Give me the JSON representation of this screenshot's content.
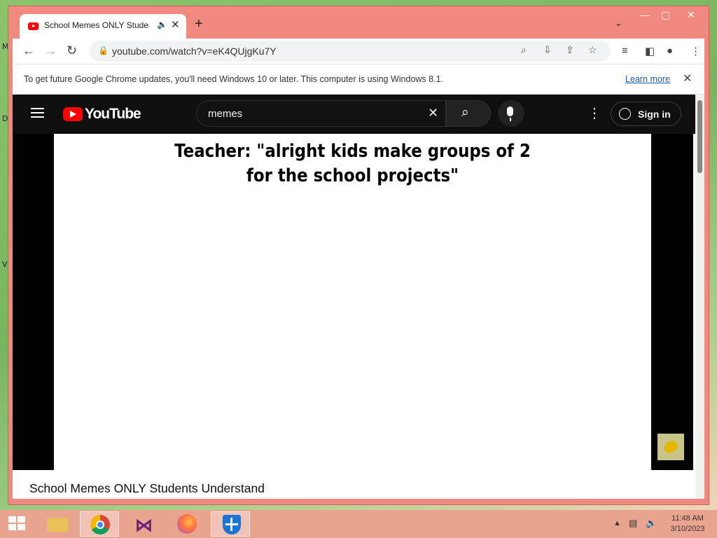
{
  "desktop": {
    "edge_letters": [
      "M",
      "D",
      "V"
    ]
  },
  "browser": {
    "tab": {
      "title": "School Memes ONLY Students Understand"
    },
    "url": "youtube.com/watch?v=eK4QUjgKu7Y",
    "infobar": {
      "message": "To get future Google Chrome updates, you'll need Windows 10 or later. This computer is using Windows 8.1.",
      "learn_more": "Learn more"
    }
  },
  "youtube": {
    "logo_text": "YouTube",
    "search_query": "memes",
    "signin_label": "Sign in",
    "video_caption_line1": "Teacher: \"alright kids make groups of 2",
    "video_caption_line2": "for the school projects\"",
    "video_title": "School Memes ONLY Students Understand"
  },
  "taskbar": {
    "apps": [
      "file-explorer",
      "chrome",
      "visual-studio",
      "firefox",
      "windows-defender"
    ],
    "clock_time": "11:48 AM",
    "clock_date": "3/10/2023"
  }
}
